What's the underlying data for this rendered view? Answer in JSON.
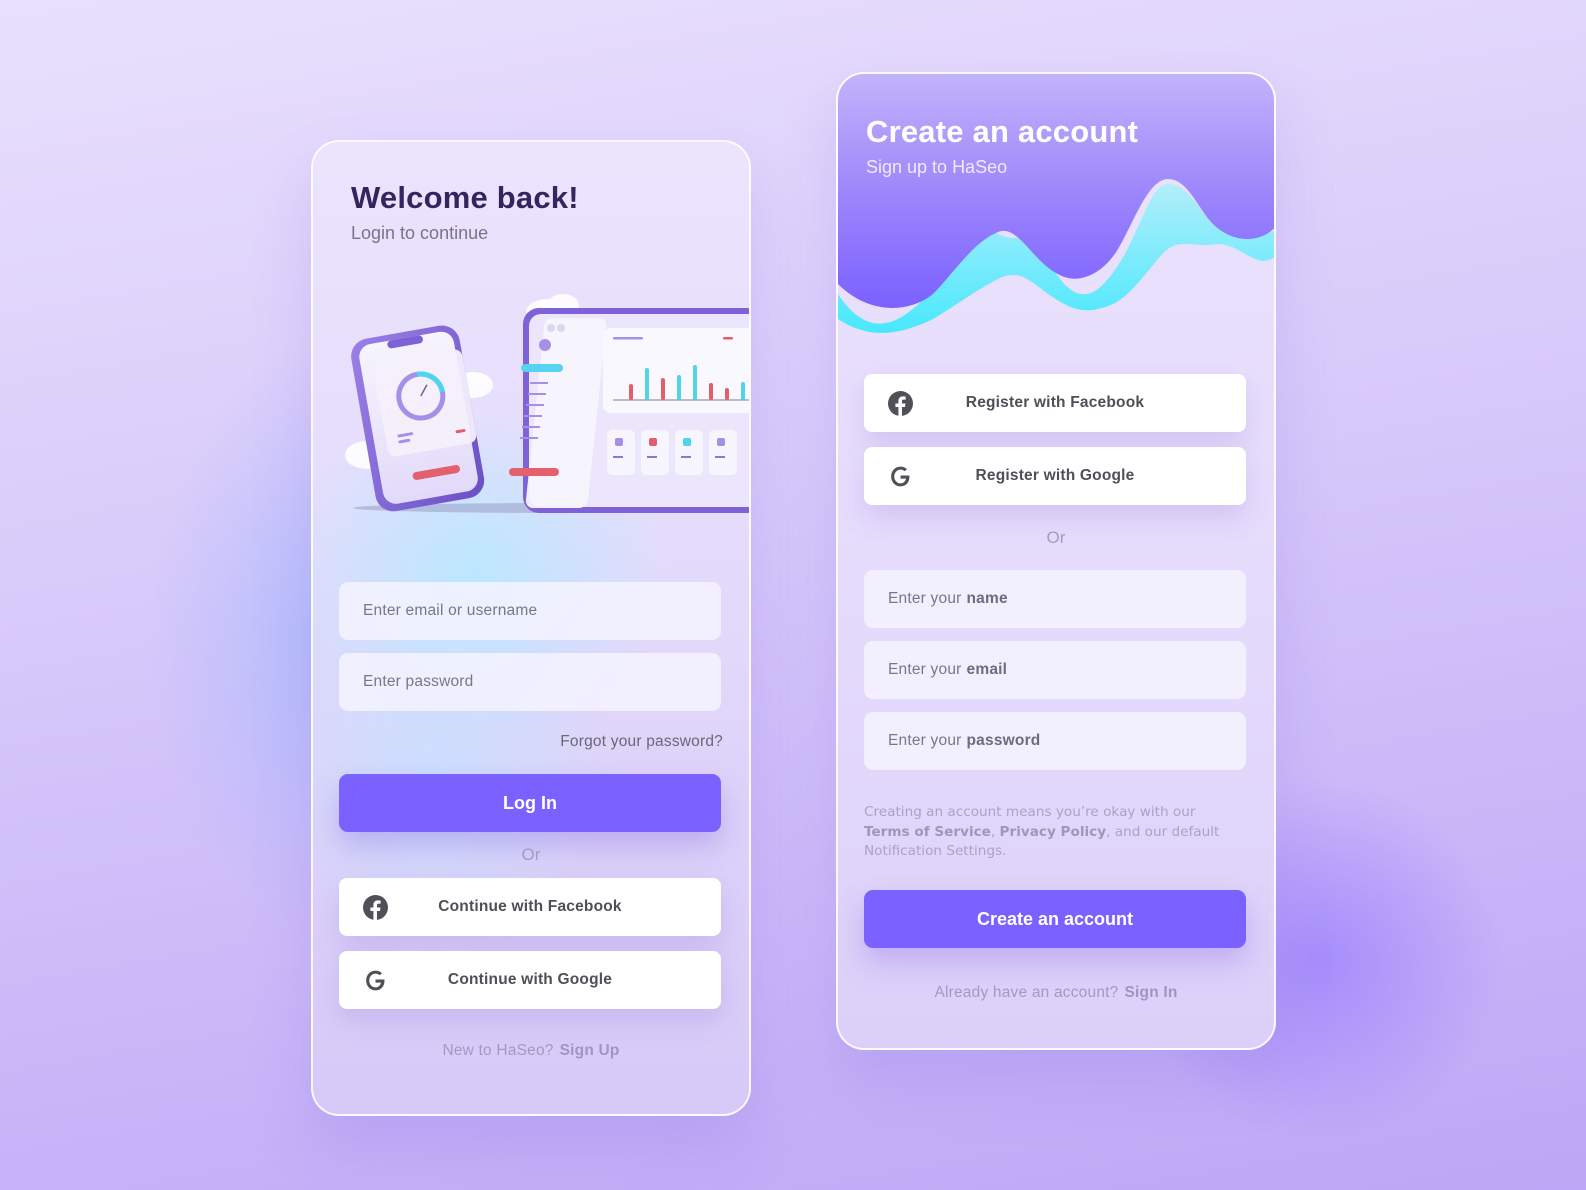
{
  "login": {
    "title": "Welcome back!",
    "subtitle": "Login to continue",
    "illustration": "phone-and-dashboard-illustration",
    "email_placeholder": "Enter email or username",
    "password_placeholder": "Enter password",
    "forgot_label": "Forgot your password?",
    "login_label": "Log In",
    "or_label": "Or",
    "facebook_label": "Continue with Facebook",
    "google_label": "Continue with Google",
    "footer_text": "New to HaSeo?",
    "footer_link": "Sign Up"
  },
  "signup": {
    "title": "Create an account",
    "subtitle": "Sign up to HaSeo",
    "facebook_label": "Register with Facebook",
    "google_label": "Register with Google",
    "or_label": "Or",
    "name_field": {
      "prefix": "Enter your",
      "emphasis": "name"
    },
    "email_field": {
      "prefix": "Enter your",
      "emphasis": "email"
    },
    "password_field": {
      "prefix": "Enter your",
      "emphasis": "password"
    },
    "terms": {
      "text_1": "Creating an account means you’re okay with our",
      "link_tos": "Terms of Service",
      "sep": ",",
      "link_privacy": "Privacy Policy",
      "text_2": ", and our default Notification Settings."
    },
    "create_label": "Create an account",
    "footer_text": "Already have an account?",
    "footer_link": "Sign In"
  },
  "colors": {
    "primary": "#7b61ff",
    "title_dark": "#36245e",
    "accent_cyan": "#4ee6f8",
    "icon_gray": "#505058"
  }
}
